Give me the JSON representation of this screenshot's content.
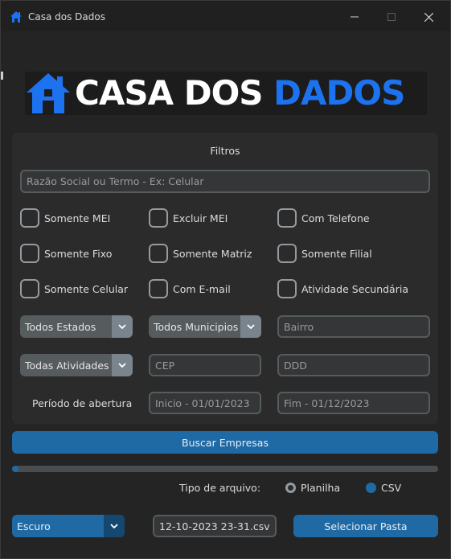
{
  "window": {
    "title": "Casa dos Dados",
    "icon": "house-icon",
    "controls": [
      "minimize-icon",
      "maximize-icon",
      "close-icon"
    ]
  },
  "logo": {
    "text_white": "CASA DOS ",
    "text_blue": "DADOS",
    "icon": "house-icon",
    "brand_color": "#1d72f0"
  },
  "filters": {
    "title": "Filtros",
    "search_placeholder": "Razão Social ou Termo - Ex: Celular",
    "checkboxes": {
      "somente_mei": "Somente MEI",
      "excluir_mei": "Excluir MEI",
      "com_telefone": "Com Telefone",
      "somente_fixo": "Somente Fixo",
      "somente_matriz": "Somente Matriz",
      "somente_filial": "Somente Filial",
      "somente_celular": "Somente Celular",
      "com_email": "Com E-mail",
      "atividade_secundaria": "Atividade Secundária"
    },
    "estado_select": "Todos Estados",
    "municipio_select": "Todos Municipios",
    "bairro_placeholder": "Bairro",
    "atividade_select": "Todas Atividades",
    "cep_placeholder": "CEP",
    "ddd_placeholder": "DDD",
    "periodo_label": "Período de abertura",
    "inicio_placeholder": "Inicio - 01/01/2023",
    "fim_placeholder": "Fim - 01/12/2023"
  },
  "actions": {
    "search_button": "Buscar Empresas",
    "progress": 0.015,
    "file_type_label": "Tipo de arquivo:",
    "file_types": {
      "planilha": "Planilha",
      "csv": "CSV"
    },
    "selected_file_type": "CSV"
  },
  "footer": {
    "theme_select": "Escuro",
    "filename": "12-10-2023 23-31.csv",
    "select_folder_button": "Selecionar Pasta"
  },
  "colors": {
    "accent": "#1f6aa5",
    "background": "#242424",
    "panel": "#2b2b2b"
  }
}
